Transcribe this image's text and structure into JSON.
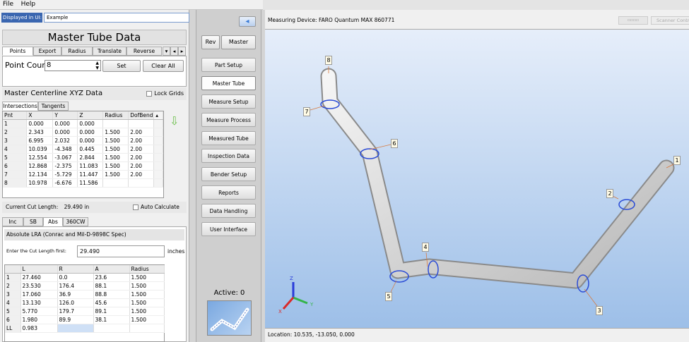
{
  "menu": [
    "File",
    "Help"
  ],
  "displayed": {
    "label": "Displayed in UI:",
    "value": "Example"
  },
  "title": "Master Tube Data",
  "tabs": [
    "Points",
    "Export",
    "Radius",
    "Translate",
    "Reverse"
  ],
  "point_count": {
    "label": "Point Count",
    "value": "8"
  },
  "buttons": {
    "set": "Set",
    "clear_all": "Clear All"
  },
  "centerline": {
    "heading": "Master Centerline XYZ Data",
    "lock_grids": "Lock Grids",
    "subtabs": [
      "Intersections",
      "Tangents"
    ],
    "columns": [
      "Pnt",
      "X",
      "Y",
      "Z",
      "Radius",
      "DofBend"
    ],
    "rows": [
      [
        "1",
        "0.000",
        "0.000",
        "0.000",
        "",
        ""
      ],
      [
        "2",
        "2.343",
        "0.000",
        "0.000",
        "1.500",
        "2.00"
      ],
      [
        "3",
        "6.995",
        "2.032",
        "0.000",
        "1.500",
        "2.00"
      ],
      [
        "4",
        "10.039",
        "-4.348",
        "0.445",
        "1.500",
        "2.00"
      ],
      [
        "5",
        "12.554",
        "-3.067",
        "2.844",
        "1.500",
        "2.00"
      ],
      [
        "6",
        "12.868",
        "-2.375",
        "11.083",
        "1.500",
        "2.00"
      ],
      [
        "7",
        "12.134",
        "-5.729",
        "11.447",
        "1.500",
        "2.00"
      ],
      [
        "8",
        "10.978",
        "-6.676",
        "11.586",
        "",
        ""
      ]
    ]
  },
  "cut_length": {
    "label": "Current Cut Length:",
    "value": "29.490 in",
    "auto": "Auto Calculate"
  },
  "lra": {
    "tabs": [
      "Inc",
      "SB",
      "Abs",
      "360CW"
    ],
    "spec": "Absolute LRA (Conrac and Mil-D-9898C Spec)",
    "enter_label": "Enter the Cut Length first:",
    "enter_value": "29.490",
    "unit": "inches",
    "columns": [
      "",
      "L",
      "R",
      "A",
      "Radius"
    ],
    "rows": [
      [
        "1",
        "27.460",
        "0.0",
        "23.6",
        "1.500"
      ],
      [
        "2",
        "23.530",
        "176.4",
        "88.1",
        "1.500"
      ],
      [
        "3",
        "17.060",
        "36.9",
        "88.8",
        "1.500"
      ],
      [
        "4",
        "13.130",
        "126.0",
        "45.6",
        "1.500"
      ],
      [
        "5",
        "5.770",
        "179.7",
        "89.1",
        "1.500"
      ],
      [
        "6",
        "1.980",
        "89.9",
        "38.1",
        "1.500"
      ],
      [
        "LL",
        "0.983",
        "",
        "",
        ""
      ]
    ]
  },
  "nav": {
    "rev": "Rev",
    "master": "Master",
    "items": [
      "Part Setup",
      "Master Tube",
      "Measure Setup",
      "Measure Process",
      "Measured Tube",
      "Inspection Data",
      "Bender Setup",
      "Reports",
      "Data Handling",
      "User Interface"
    ],
    "active_label": "Active: 0"
  },
  "viewport": {
    "device": "Measuring Device: FARO Quantum MAX 860771",
    "scanner": "Scanner Contr",
    "location": "Location: 10.535, -13.050, 0.000",
    "labels": [
      "1",
      "2",
      "3",
      "4",
      "5",
      "6",
      "7",
      "8"
    ],
    "axes": {
      "x": "X",
      "y": "Y",
      "z": "Z"
    }
  }
}
